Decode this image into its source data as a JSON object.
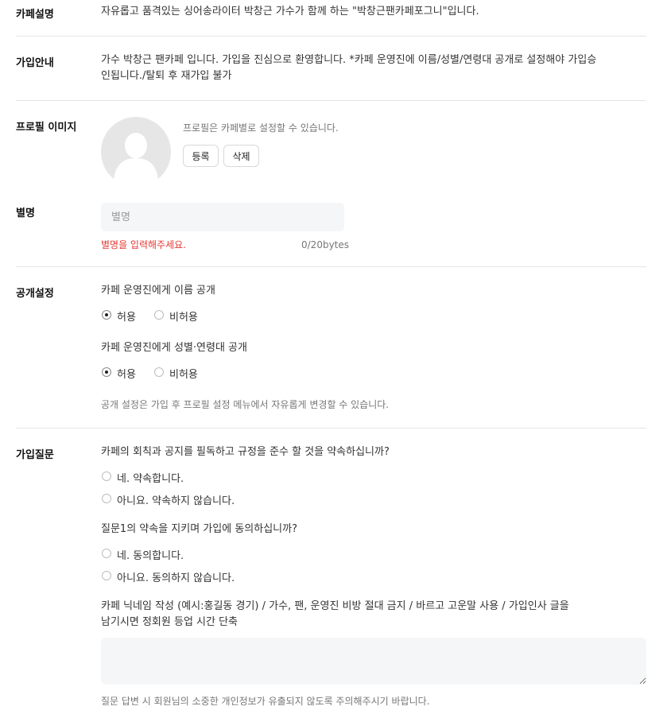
{
  "sections": {
    "cafe_desc": {
      "label": "카페설명",
      "text": "자유롭고 품격있는 싱어송라이터 박창근 가수가 함께 하는 \"박창근팬카페포그니\"입니다."
    },
    "join_guide": {
      "label": "가입안내",
      "line1": "가수 박창근 팬카페 입니다. 가입을 진심으로 환영합니다. *카페 운영진에 이름/성별/연령대 공개로 설정해야 가입승",
      "line2": "인됩니다./탈퇴 후 재가입 불가"
    },
    "profile": {
      "label": "프로필 이미지",
      "hint": "프로필은 카페별로 설정할 수 있습니다.",
      "register_label": "등록",
      "delete_label": "삭제"
    },
    "nickname": {
      "label": "별명",
      "placeholder": "별명",
      "error": "별명을 입력해주세요.",
      "counter": "0/20bytes"
    },
    "privacy": {
      "label": "공개설정",
      "q1": "카페 운영진에게 이름 공개",
      "q2": "카페 운영진에게 성별·연령대 공개",
      "allow": "허용",
      "deny": "비허용",
      "note": "공개 설정은 가입 후 프로필 설정 메뉴에서 자유롭게 변경할 수 있습니다."
    },
    "questions": {
      "label": "가입질문",
      "q1": "카페의 회칙과 공지를 필독하고 규정을 준수 할 것을 약속하십니까?",
      "q1_yes": "네. 약속합니다.",
      "q1_no": "아니요. 약속하지 않습니다.",
      "q2": "질문1의 약속을 지키며 가입에 동의하십니까?",
      "q2_yes": "네. 동의합니다.",
      "q2_no": "아니요. 동의하지 않습니다.",
      "q3_line1": "카페 닉네임 작성 (예시:홍길동 경기) / 가수, 팬, 운영진 비방 절대 금지 / 바르고 고운말 사용 / 가입인사 글을",
      "q3_line2": "남기시면 정회원 등업 시간 단축",
      "footer": "질문 답변 시 회원님의 소중한 개인정보가 유출되지 않도록 주의해주시기 바랍니다."
    }
  }
}
